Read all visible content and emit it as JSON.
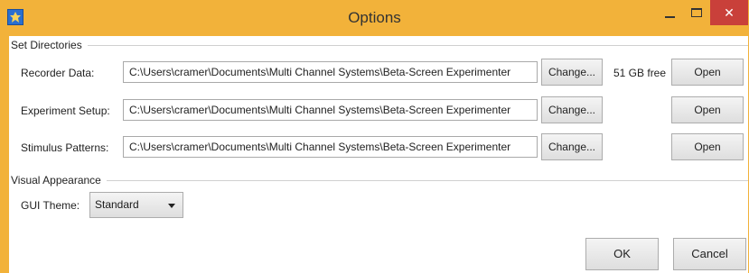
{
  "window": {
    "title": "Options",
    "icon": "app-logo-icon",
    "controls": {
      "minimize": "minimize-icon",
      "maximize": "maximize-icon",
      "close": "✕"
    },
    "frame_color": "#f2b23a",
    "close_color": "#c9403a"
  },
  "directories": {
    "header": "Set Directories",
    "rows": [
      {
        "label": "Recorder Data:",
        "path": "C:\\Users\\cramer\\Documents\\Multi Channel Systems\\Beta-Screen Experimenter",
        "change": "Change...",
        "free": "51 GB free",
        "open": "Open"
      },
      {
        "label": "Experiment Setup:",
        "path": "C:\\Users\\cramer\\Documents\\Multi Channel Systems\\Beta-Screen Experimenter",
        "change": "Change...",
        "open": "Open"
      },
      {
        "label": "Stimulus Patterns:",
        "path": "C:\\Users\\cramer\\Documents\\Multi Channel Systems\\Beta-Screen Experimenter",
        "change": "Change...",
        "open": "Open"
      }
    ]
  },
  "appearance": {
    "header": "Visual Appearance",
    "theme_label": "GUI Theme:",
    "theme_value": "Standard"
  },
  "footer": {
    "ok": "OK",
    "cancel": "Cancel"
  }
}
